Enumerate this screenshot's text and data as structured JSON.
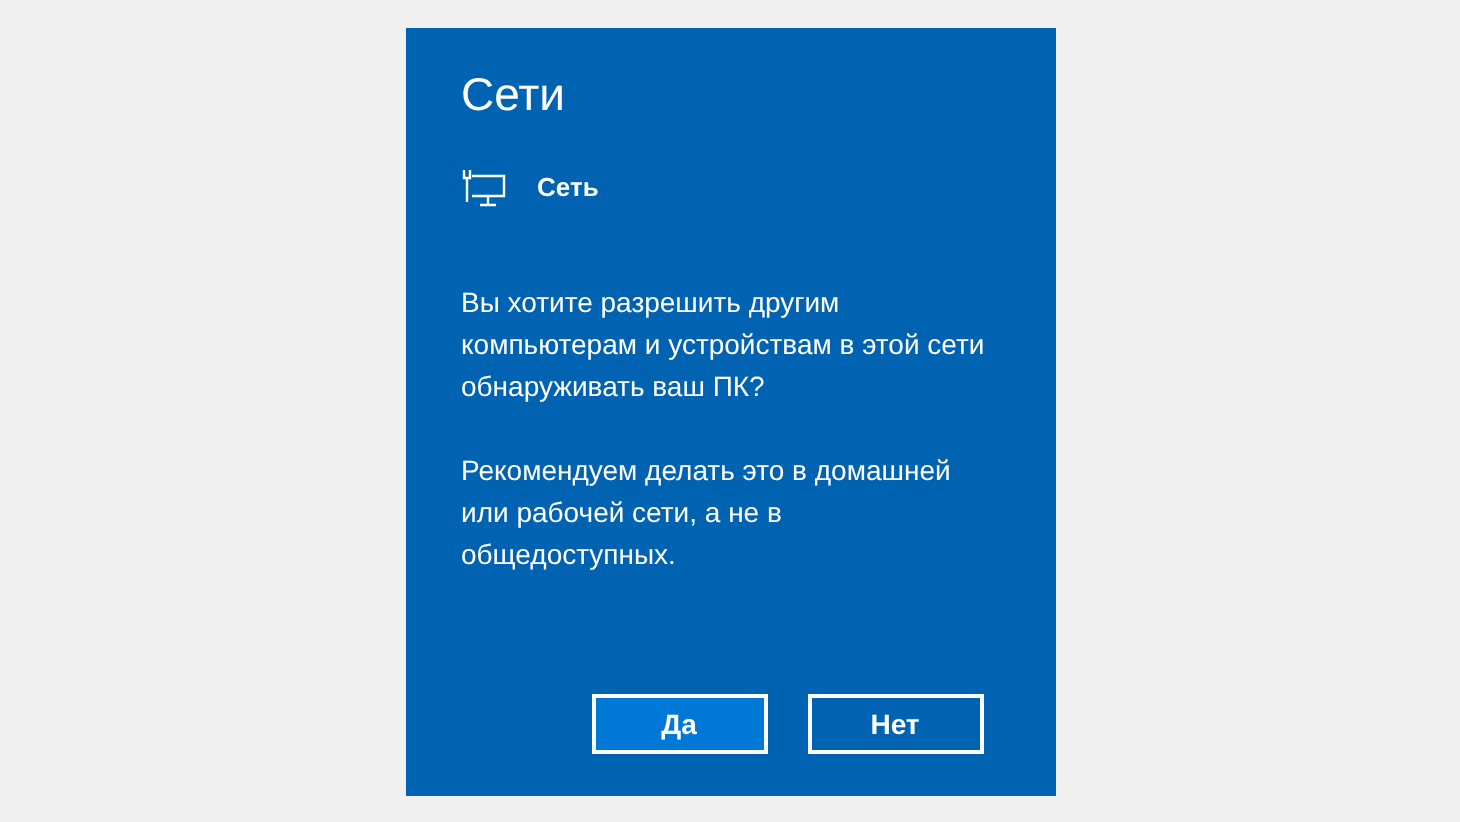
{
  "panel": {
    "title": "Сети",
    "network": {
      "name": "Сеть"
    },
    "paragraphs": [
      "Вы хотите разрешить другим компьютерам и устройствам в этой сети обнаруживать ваш ПК?",
      "Рекомендуем делать это в домашней или рабочей сети, а не в общедоступных."
    ],
    "buttons": [
      {
        "label": "Да",
        "default": true
      },
      {
        "label": "Нет",
        "default": false
      }
    ]
  }
}
